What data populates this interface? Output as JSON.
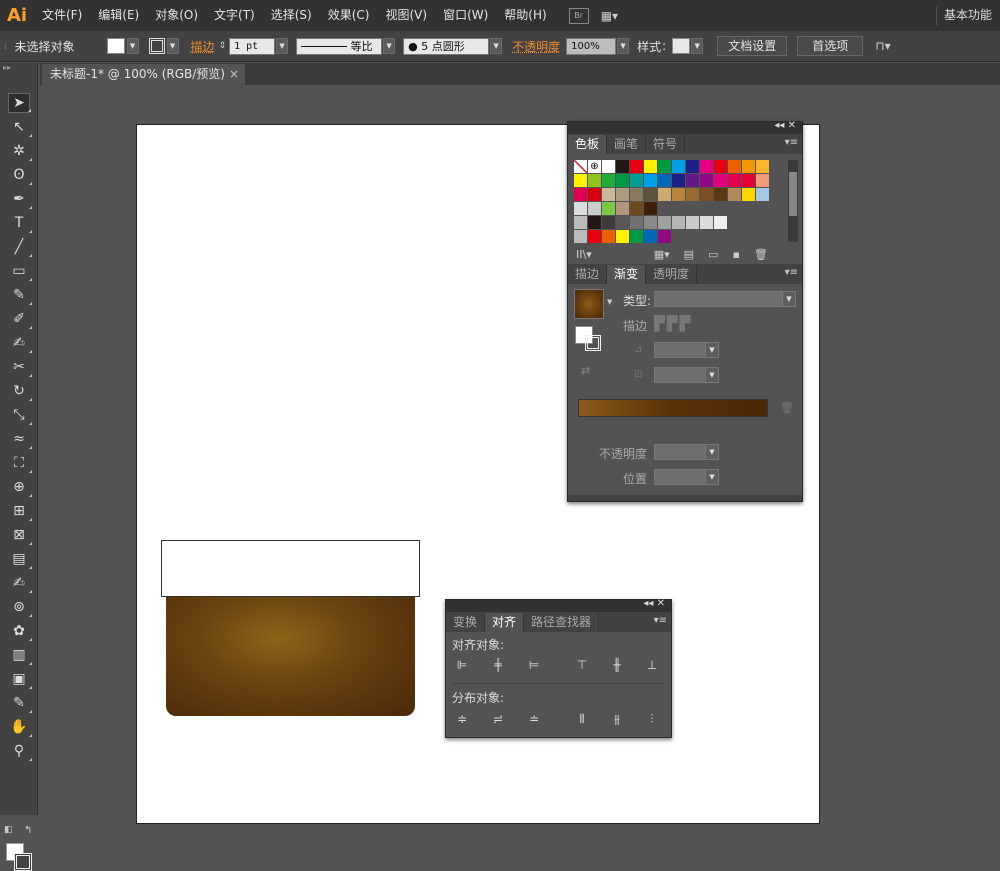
{
  "app": {
    "logo": "Ai"
  },
  "menu": [
    "文件(F)",
    "编辑(E)",
    "对象(O)",
    "文字(T)",
    "选择(S)",
    "效果(C)",
    "视图(V)",
    "窗口(W)",
    "帮助(H)"
  ],
  "menubar": {
    "bridge": "Br",
    "workspace": "基本功能"
  },
  "control": {
    "selection": "未选择对象",
    "stroke_label": "描边",
    "stroke_weight": "1 pt",
    "stroke_profile": "等比",
    "brush": "5 点圆形",
    "opacity_label": "不透明度",
    "opacity_value": "100%",
    "style_label": "样式",
    "doc_setup": "文档设置",
    "preferences": "首选项"
  },
  "document": {
    "tab_title": "未标题-1* @ 100% (RGB/预览)"
  },
  "swatches_panel": {
    "tabs": [
      "色板",
      "画笔",
      "符号"
    ],
    "active_tab": "色板",
    "rows": [
      [
        "#ffffff",
        "#ffffff",
        "#ffffff",
        "#231815",
        "#e60012",
        "#fff100",
        "#009944",
        "#00a0e9",
        "#1d2088",
        "#e4007f",
        "#e60012",
        "#eb6100",
        "#f39800",
        "#f8b62d"
      ],
      [
        "#fff100",
        "#8fc31f",
        "#22ac38",
        "#009944",
        "#009e96",
        "#00a0e9",
        "#0068b7",
        "#1d2088",
        "#601986",
        "#920783",
        "#e4007f",
        "#e5004f",
        "#e60033",
        "#f29b76"
      ],
      [
        "#e5004f",
        "#d7000f",
        "#c9b99c",
        "#aa9d7f",
        "#8a7a5d",
        "#5f5441",
        "#cfa972",
        "#b8843d",
        "#996c33",
        "#7e4f23",
        "#5c3812",
        "#b08a5a",
        "#ffd700",
        "#a5c8e6"
      ],
      [
        "#cccccc",
        "#7ac943",
        "#b1967c",
        "#6b4a1d",
        "#3e2008"
      ],
      [
        "#231815",
        "#3e3a39",
        "#595757",
        "#727171",
        "#898989",
        "#9fa0a0",
        "#b5b5b6",
        "#c9caca",
        "#dcdddd",
        "#efefef"
      ],
      [
        "#e60012",
        "#eb6100",
        "#fff100",
        "#009944",
        "#0068b7",
        "#920783"
      ]
    ]
  },
  "gradient_panel": {
    "tabs": [
      "描边",
      "渐变",
      "透明度"
    ],
    "active_tab": "渐变",
    "type_label": "类型:",
    "stroke_label": "描边",
    "opacity_label": "不透明度",
    "position_label": "位置",
    "gradient_colors": [
      "#8a5a1a",
      "#5a3208",
      "#4a2606"
    ]
  },
  "align_panel": {
    "tabs": [
      "变换",
      "对齐",
      "路径查找器"
    ],
    "active_tab": "对齐",
    "align_objects_label": "对齐对象:",
    "distribute_objects_label": "分布对象:"
  },
  "artwork": {
    "colors": {
      "lid": "#ffffff",
      "body_center": "#8f6418",
      "body_edge": "#4a2707"
    }
  }
}
